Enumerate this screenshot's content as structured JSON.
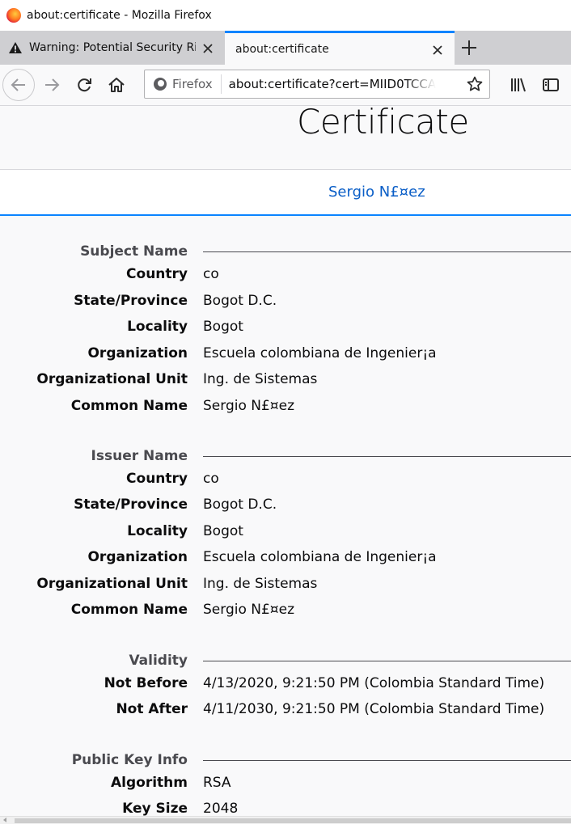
{
  "window": {
    "title": "about:certificate - Mozilla Firefox"
  },
  "tabs": [
    {
      "label": "Warning: Potential Security Risk Ahead",
      "icon": "warning-icon",
      "active": false
    },
    {
      "label": "about:certificate",
      "active": true
    }
  ],
  "navbar": {
    "identity_label": "Firefox",
    "url": "about:certificate?cert=MIID0TCCArmgAwIBAgIU"
  },
  "page": {
    "heading": "Certificate",
    "cert_tab_label": "Sergio N£¤ez"
  },
  "sections": {
    "subject": {
      "title": "Subject Name",
      "rows": [
        {
          "label": "Country",
          "value": "co"
        },
        {
          "label": "State/Province",
          "value": "Bogot  D.C."
        },
        {
          "label": "Locality",
          "value": "Bogot"
        },
        {
          "label": "Organization",
          "value": "Escuela colombiana de Ingenier¡a"
        },
        {
          "label": "Organizational Unit",
          "value": "Ing. de Sistemas"
        },
        {
          "label": "Common Name",
          "value": "Sergio N£¤ez"
        }
      ]
    },
    "issuer": {
      "title": "Issuer Name",
      "rows": [
        {
          "label": "Country",
          "value": "co"
        },
        {
          "label": "State/Province",
          "value": "Bogot  D.C."
        },
        {
          "label": "Locality",
          "value": "Bogot"
        },
        {
          "label": "Organization",
          "value": "Escuela colombiana de Ingenier¡a"
        },
        {
          "label": "Organizational Unit",
          "value": "Ing. de Sistemas"
        },
        {
          "label": "Common Name",
          "value": "Sergio N£¤ez"
        }
      ]
    },
    "validity": {
      "title": "Validity",
      "rows": [
        {
          "label": "Not Before",
          "value": "4/13/2020, 9:21:50 PM (Colombia Standard Time)"
        },
        {
          "label": "Not After",
          "value": "4/11/2030, 9:21:50 PM (Colombia Standard Time)"
        }
      ]
    },
    "public_key": {
      "title": "Public Key Info",
      "rows": [
        {
          "label": "Algorithm",
          "value": "RSA"
        },
        {
          "label": "Key Size",
          "value": "2048"
        }
      ]
    }
  },
  "colors": {
    "accent": "#0a84ff",
    "link": "#0a5ec7",
    "tabstrip": "#cfcfd2",
    "page_bg": "#f9f9fa"
  }
}
